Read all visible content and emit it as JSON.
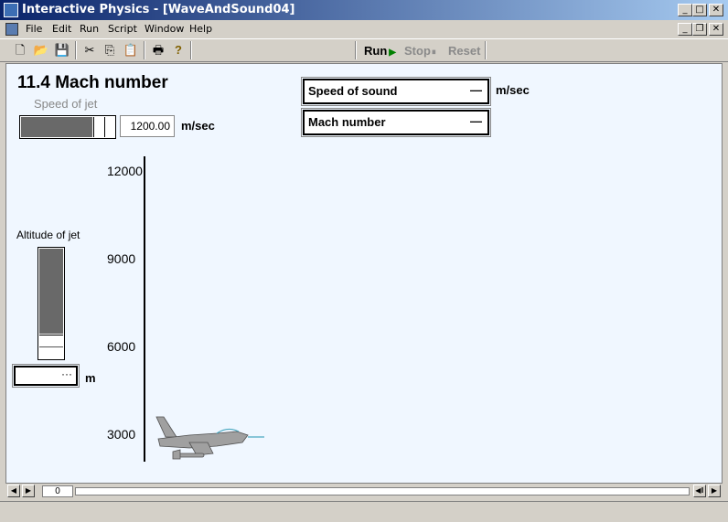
{
  "window": {
    "title": "Interactive Physics - [WaveAndSound04]",
    "minimize_glyph": "_",
    "maximize_glyph": "□",
    "close_glyph": "✕",
    "restore_glyph": "❐"
  },
  "menu": [
    "File",
    "Edit",
    "Run",
    "Script",
    "Window",
    "Help"
  ],
  "toolbar": {
    "icons": [
      "new-icon",
      "open-icon",
      "save-icon",
      "cut-icon",
      "copy-icon",
      "paste-icon",
      "print-icon",
      "help-icon"
    ],
    "glyphs": {
      "new": "🗋",
      "open": "📂",
      "save": "💾",
      "cut": "✂",
      "copy": "⎘",
      "paste": "📋",
      "print": "🖶",
      "help": "?"
    },
    "run_label": "Run",
    "run_glyph": "▶",
    "stop_label": "Stop",
    "stop_glyph": "⏸",
    "reset_label": "Reset",
    "run_color": "#008000",
    "disabled_color": "#8a8a8a"
  },
  "canvas": {
    "heading": "11.4 Mach number",
    "speed_of_jet": {
      "label": "Speed of jet",
      "value": "1200.00",
      "unit": "m/sec",
      "slider_fraction": 0.75
    },
    "speed_of_sound": {
      "label": "Speed of sound",
      "value": "—",
      "unit": "m/sec"
    },
    "mach_number": {
      "label": "Mach number",
      "value": "—"
    },
    "altitude_of_jet": {
      "label": "Altitude of jet",
      "value": "···",
      "unit": "m",
      "slider_fraction": 0.75
    },
    "axis_ticks": [
      "12000",
      "9000",
      "6000",
      "3000"
    ],
    "jet_color": "#a0a0a0"
  },
  "timeline": {
    "frame": "0",
    "left_glyph": "◀",
    "play_glyph": "▶",
    "end_glyph": "◀‖",
    "right_glyph": "▶"
  }
}
